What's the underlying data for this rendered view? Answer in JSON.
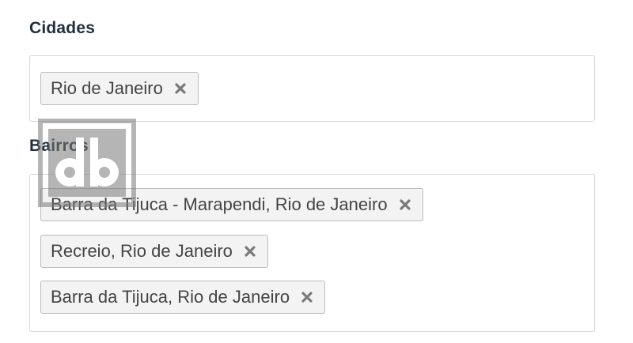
{
  "cidades": {
    "label": "Cidades",
    "tags": [
      {
        "label": "Rio de Janeiro",
        "remove_icon": "close-icon"
      }
    ]
  },
  "bairros": {
    "label": "Bairros",
    "tags": [
      {
        "label": "Barra da Tijuca - Marapendi, Rio de Janeiro",
        "remove_icon": "close-icon"
      },
      {
        "label": "Recreio, Rio de Janeiro",
        "remove_icon": "close-icon"
      },
      {
        "label": "Barra da Tijuca, Rio de Janeiro",
        "remove_icon": "close-icon"
      }
    ]
  },
  "watermark": {
    "text": "db"
  },
  "colors": {
    "label": "#1f2f3d",
    "tag_background": "#f3f3f3",
    "tag_border": "#bdbdbd",
    "remove_icon": "#7a7a7a",
    "box_border": "#d6d6d6"
  }
}
